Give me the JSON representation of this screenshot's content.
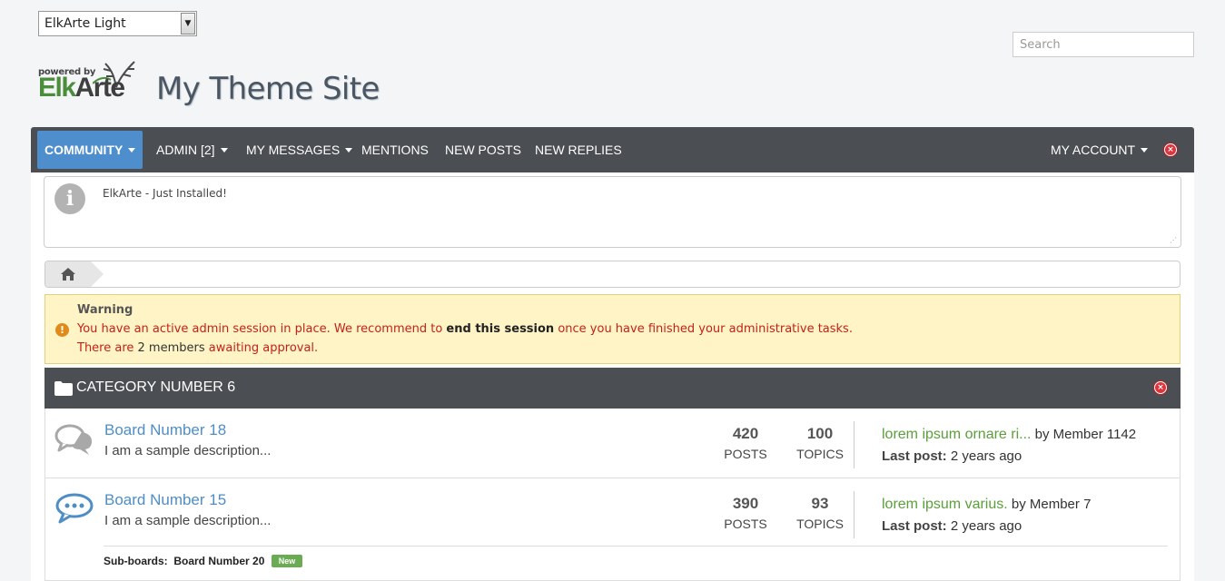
{
  "theme_selector": {
    "value": "ElkArte Light"
  },
  "search": {
    "placeholder": "Search"
  },
  "logo": {
    "powered": "powered by",
    "elk": "Elk",
    "arte": "Arte"
  },
  "site_title": "My Theme Site",
  "menu": {
    "items": [
      {
        "label": "COMMUNITY",
        "dropdown": true,
        "active": true
      },
      {
        "label": "ADMIN [2]",
        "dropdown": true
      },
      {
        "label": "MY MESSAGES",
        "dropdown": true
      },
      {
        "label": "MENTIONS"
      },
      {
        "label": "NEW POSTS"
      },
      {
        "label": "NEW REPLIES"
      }
    ],
    "account": {
      "label": "MY ACCOUNT",
      "dropdown": true
    }
  },
  "news": {
    "text": "ElkArte - Just Installed!"
  },
  "warning": {
    "title": "Warning",
    "line1_pre": "You have an active admin session in place. We recommend to ",
    "line1_link": "end this session",
    "line1_post": " once you have finished your administrative tasks.",
    "line2_pre": "There are ",
    "line2_count": "2 members",
    "line2_link": "awaiting approval",
    "line2_post": "."
  },
  "category": {
    "name": "CATEGORY NUMBER 6"
  },
  "boards": [
    {
      "name": "Board Number 18",
      "description": "I am a sample description...",
      "posts": "420",
      "posts_label": "POSTS",
      "topics": "100",
      "topics_label": "TOPICS",
      "last_topic": "lorem ipsum ornare ri...",
      "by": "by Member 1142",
      "last_post_label": "Last post:",
      "last_post_time": "2 years ago",
      "icon": "chat-icon-read"
    },
    {
      "name": "Board Number 15",
      "description": "I am a sample description...",
      "posts": "390",
      "posts_label": "POSTS",
      "topics": "93",
      "topics_label": "TOPICS",
      "last_topic": "lorem ipsum varius.",
      "by": "by Member 7",
      "last_post_label": "Last post:",
      "last_post_time": "2 years ago",
      "icon": "chat-icon-new",
      "subboards_label": "Sub-boards:",
      "subboard": "Board Number 20",
      "new_badge": "New"
    }
  ],
  "colors": {
    "menubar": "#4b4e52",
    "accent": "#4f8ecc",
    "link_green": "#5b9e3b",
    "warning_bg": "#fef4c5"
  }
}
